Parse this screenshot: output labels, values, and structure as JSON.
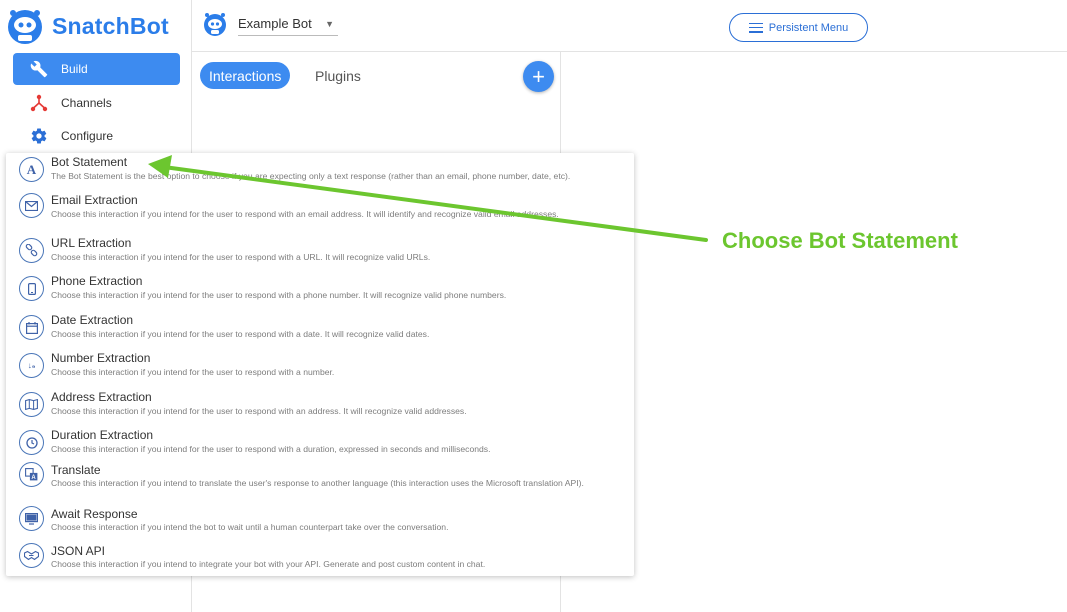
{
  "app": {
    "brand": "SnatchBot"
  },
  "sidebar": {
    "items": [
      {
        "label": "Build",
        "icon": "wrench-icon",
        "active": true
      },
      {
        "label": "Channels",
        "icon": "channels-icon",
        "active": false
      },
      {
        "label": "Configure",
        "icon": "gear-icon",
        "active": false
      }
    ]
  },
  "header": {
    "bot_name": "Example Bot",
    "persistent_menu_label": "Persistent Menu"
  },
  "panel": {
    "tabs": [
      {
        "label": "Interactions",
        "active": true
      },
      {
        "label": "Plugins",
        "active": false
      }
    ],
    "add_label": "+"
  },
  "menu": {
    "items": [
      {
        "title": "Bot Statement",
        "icon": "letter-a-icon",
        "desc": "The Bot Statement is the best option to choose if you are expecting only a text response (rather than an email, phone number, date, etc)."
      },
      {
        "title": "Email Extraction",
        "icon": "envelope-icon",
        "desc": "Choose this interaction if you intend for the user to respond with an email address. It will identify and recognize valid email addresses."
      },
      {
        "title": "URL Extraction",
        "icon": "link-icon",
        "desc": "Choose this interaction if you intend for the user to respond with a URL. It will recognize valid URLs."
      },
      {
        "title": "Phone Extraction",
        "icon": "phone-icon",
        "desc": "Choose this interaction if you intend for the user to respond with a phone number. It will recognize valid phone numbers."
      },
      {
        "title": "Date Extraction",
        "icon": "calendar-icon",
        "desc": "Choose this interaction if you intend for the user to respond with a date. It will recognize valid dates."
      },
      {
        "title": "Number Extraction",
        "icon": "number-sort-icon",
        "desc": "Choose this interaction if you intend for the user to respond with a number."
      },
      {
        "title": "Address Extraction",
        "icon": "map-icon",
        "desc": "Choose this interaction if you intend for the user to respond with an address. It will recognize valid addresses."
      },
      {
        "title": "Duration Extraction",
        "icon": "clock-icon",
        "desc": "Choose this interaction if you intend for the user to respond with a duration, expressed in seconds and milliseconds."
      },
      {
        "title": "Translate",
        "icon": "translate-icon",
        "desc": "Choose this interaction if you intend to translate the user's response to another language (this interaction uses the Microsoft translation API)."
      },
      {
        "title": "Await Response",
        "icon": "monitor-icon",
        "desc": "Choose this interaction if you intend the bot to wait until a human counterpart take over the conversation."
      },
      {
        "title": "JSON API",
        "icon": "handshake-icon",
        "desc": "Choose this interaction if you intend to integrate your bot with your API. Generate and post custom content in chat."
      }
    ]
  },
  "annotation": {
    "text": "Choose Bot Statement",
    "color": "#6cc62f"
  },
  "colors": {
    "accent": "#3d8bf0",
    "brand": "#2b7de9"
  }
}
